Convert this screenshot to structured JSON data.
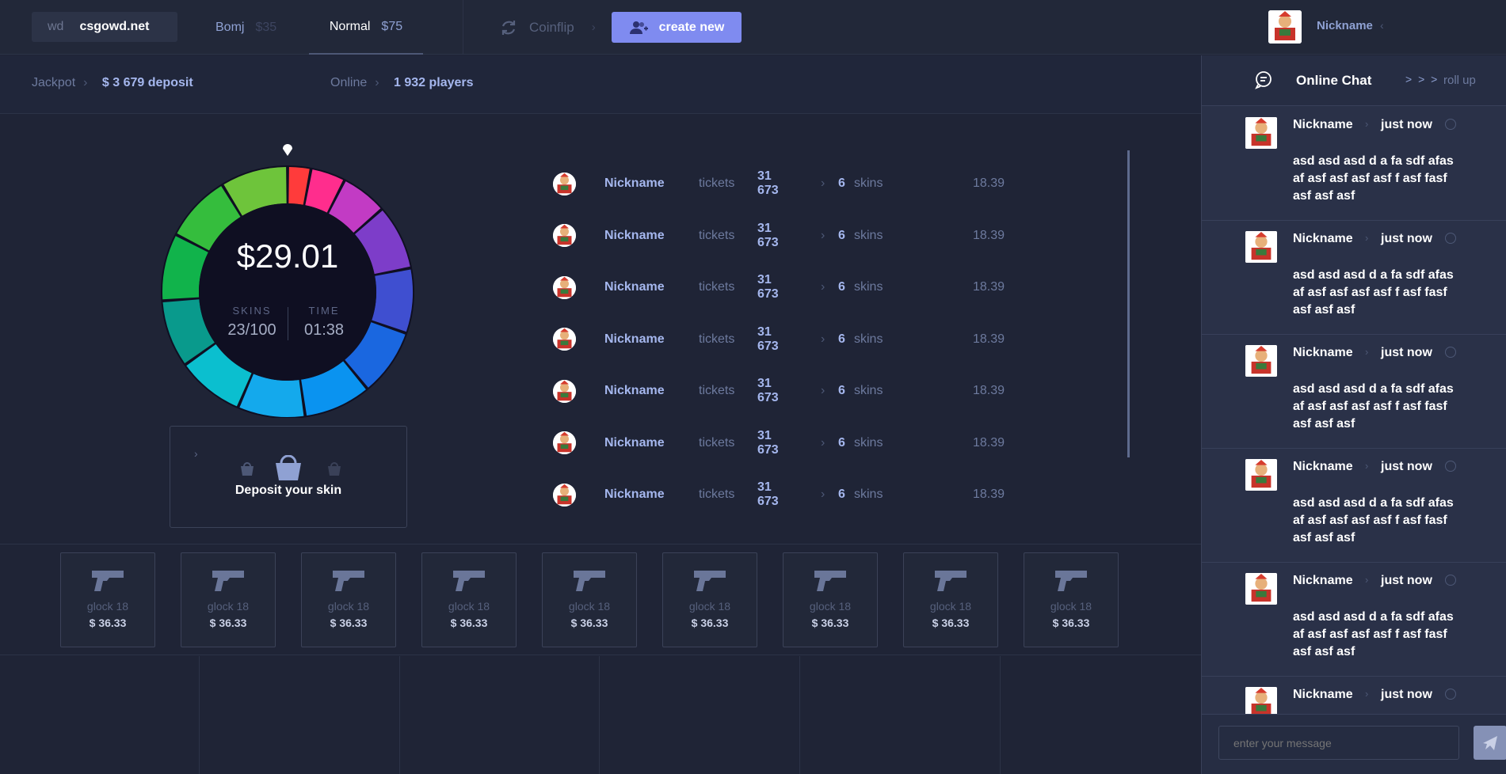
{
  "header": {
    "site_prefix": "wd",
    "site_name": "csgowd.net",
    "modes": [
      {
        "label": "Bomj",
        "amount": "$35"
      },
      {
        "label": "Normal",
        "amount": "$75"
      }
    ],
    "coinflip_label": "Coinflip",
    "create_label": "create new",
    "user_name": "Nickname"
  },
  "infobar": {
    "jackpot_label": "Jackpot",
    "jackpot_value": "$ 3 679 deposit",
    "online_label": "Online",
    "online_value": "1 932 players"
  },
  "wheel": {
    "pot": "$29.01",
    "skins_label": "SKINS",
    "skins_value": "23/100",
    "time_label": "TIME",
    "time_value": "01:38",
    "segment_colors": [
      "#ff3b3b",
      "#ff2d8d",
      "#c23bc4",
      "#7d3dc9",
      "#3f4fd0",
      "#1a67e0",
      "#0a93f0",
      "#14a9ec",
      "#0bbfcf",
      "#099a8c",
      "#11b34b",
      "#35bd3d",
      "#6ec43b"
    ]
  },
  "deposit": {
    "label": "Deposit your skin"
  },
  "players": [
    {
      "name": "Nickname",
      "tickets_label": "tickets",
      "tickets": "31 673",
      "skins_count": "6",
      "skins_label": "skins",
      "chance": "18.39"
    },
    {
      "name": "Nickname",
      "tickets_label": "tickets",
      "tickets": "31 673",
      "skins_count": "6",
      "skins_label": "skins",
      "chance": "18.39"
    },
    {
      "name": "Nickname",
      "tickets_label": "tickets",
      "tickets": "31 673",
      "skins_count": "6",
      "skins_label": "skins",
      "chance": "18.39"
    },
    {
      "name": "Nickname",
      "tickets_label": "tickets",
      "tickets": "31 673",
      "skins_count": "6",
      "skins_label": "skins",
      "chance": "18.39"
    },
    {
      "name": "Nickname",
      "tickets_label": "tickets",
      "tickets": "31 673",
      "skins_count": "6",
      "skins_label": "skins",
      "chance": "18.39"
    },
    {
      "name": "Nickname",
      "tickets_label": "tickets",
      "tickets": "31 673",
      "skins_count": "6",
      "skins_label": "skins",
      "chance": "18.39"
    },
    {
      "name": "Nickname",
      "tickets_label": "tickets",
      "tickets": "31 673",
      "skins_count": "6",
      "skins_label": "skins",
      "chance": "18.39"
    }
  ],
  "items": [
    {
      "name": "glock 18",
      "price": "$ 36.33"
    },
    {
      "name": "glock 18",
      "price": "$ 36.33"
    },
    {
      "name": "glock 18",
      "price": "$ 36.33"
    },
    {
      "name": "glock 18",
      "price": "$ 36.33"
    },
    {
      "name": "glock 18",
      "price": "$ 36.33"
    },
    {
      "name": "glock 18",
      "price": "$ 36.33"
    },
    {
      "name": "glock 18",
      "price": "$ 36.33"
    },
    {
      "name": "glock 18",
      "price": "$ 36.33"
    },
    {
      "name": "glock 18",
      "price": "$ 36.33"
    }
  ],
  "chat": {
    "title": "Online Chat",
    "arrows": "> > >",
    "rollup_label": "roll up",
    "messages": [
      {
        "name": "Nickname",
        "time": "just now",
        "text": "asd asd asd d a fa sdf afas af asf asf asf asf f asf fasf asf asf asf"
      },
      {
        "name": "Nickname",
        "time": "just now",
        "text": "asd asd asd d a fa sdf afas af asf asf asf asf f asf fasf asf asf asf"
      },
      {
        "name": "Nickname",
        "time": "just now",
        "text": "asd asd asd d a fa sdf afas af asf asf asf asf f asf fasf asf asf asf"
      },
      {
        "name": "Nickname",
        "time": "just now",
        "text": "asd asd asd d a fa sdf afas af asf asf asf asf f asf fasf asf asf asf"
      },
      {
        "name": "Nickname",
        "time": "just now",
        "text": "asd asd asd d a fa sdf afas af asf asf asf asf f asf fasf asf asf asf"
      },
      {
        "name": "Nickname",
        "time": "just now",
        "text": ""
      }
    ],
    "input_placeholder": "enter your message"
  }
}
